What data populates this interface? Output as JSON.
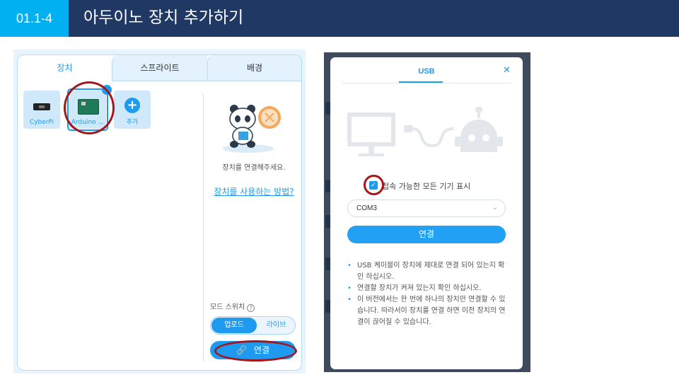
{
  "slide": {
    "number": "01.1-4",
    "title": "아두이노 장치 추가하기"
  },
  "colors": {
    "title_bar": "#1f3864",
    "number_badge": "#00b0f0",
    "accent": "#1e9bf0",
    "highlight_ring": "#a3161b"
  },
  "device_panel": {
    "tabs": [
      "장치",
      "스프라이트",
      "배경"
    ],
    "active_tab": "장치",
    "devices": [
      {
        "label": "CyberPi",
        "icon": "cyberpi-board-icon"
      },
      {
        "label": "Arduino ...",
        "icon": "arduino-board-icon",
        "selected": true
      },
      {
        "label": "추가",
        "icon": "plus-icon"
      }
    ],
    "connect_message": "장치를 연결해주세요.",
    "howto_link": "장치를 사용하는 방법?",
    "mode_switch_label": "모드 스위치",
    "mode_options": [
      "업로드",
      "라이브"
    ],
    "mode_selected": "업로드",
    "connect_button": "연결"
  },
  "usb_dialog": {
    "tab": "USB",
    "close_icon": "close-icon",
    "show_all_label": "접속 가능한 모든 기기 표시",
    "show_all_checked": true,
    "port_value": "COM3",
    "connect_button": "연결",
    "notes": [
      "USB 케이블이 장치에 제대로 연결 되어 있는지 확인 하십시오.",
      "연결할 장치가 켜져 있는지 확인 하십시오.",
      "이 버전에서는 한 번에 하나의 장치만 연결할 수 있습니다. 따라서이 장치를 연결 하면 이전 장치의 연결이 끊어질 수 있습니다."
    ]
  }
}
